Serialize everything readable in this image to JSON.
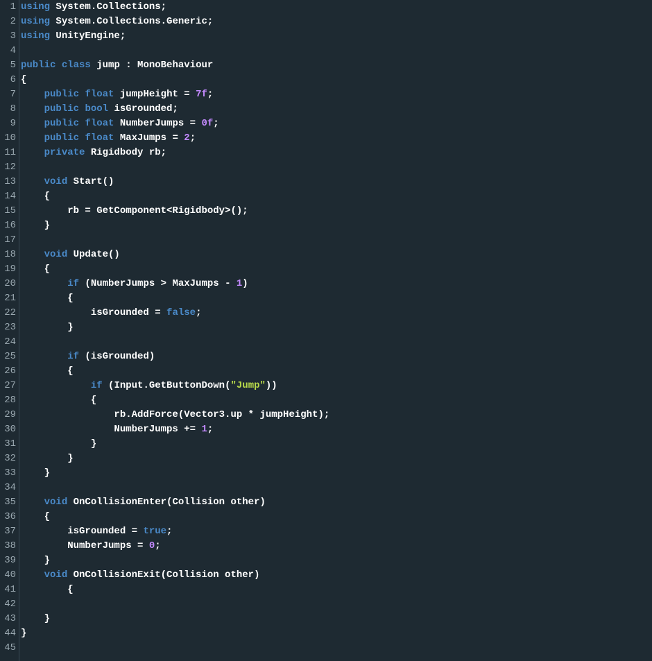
{
  "lines": [
    {
      "n": 1,
      "tokens": [
        {
          "t": "using",
          "c": "kw"
        },
        {
          "t": " System.Collections;",
          "c": "ident"
        }
      ]
    },
    {
      "n": 2,
      "tokens": [
        {
          "t": "using",
          "c": "kw"
        },
        {
          "t": " System.Collections.Generic;",
          "c": "ident"
        }
      ]
    },
    {
      "n": 3,
      "tokens": [
        {
          "t": "using",
          "c": "kw"
        },
        {
          "t": " UnityEngine;",
          "c": "ident"
        }
      ]
    },
    {
      "n": 4,
      "tokens": []
    },
    {
      "n": 5,
      "tokens": [
        {
          "t": "public",
          "c": "kw"
        },
        {
          "t": " ",
          "c": "ident"
        },
        {
          "t": "class",
          "c": "kw"
        },
        {
          "t": " jump : MonoBehaviour",
          "c": "ident"
        }
      ]
    },
    {
      "n": 6,
      "tokens": [
        {
          "t": "{",
          "c": "punc"
        }
      ]
    },
    {
      "n": 7,
      "tokens": [
        {
          "t": "    ",
          "c": "ident"
        },
        {
          "t": "public",
          "c": "kw"
        },
        {
          "t": " ",
          "c": "ident"
        },
        {
          "t": "float",
          "c": "type"
        },
        {
          "t": " jumpHeight = ",
          "c": "ident"
        },
        {
          "t": "7f",
          "c": "num"
        },
        {
          "t": ";",
          "c": "punc"
        }
      ]
    },
    {
      "n": 8,
      "tokens": [
        {
          "t": "    ",
          "c": "ident"
        },
        {
          "t": "public",
          "c": "kw"
        },
        {
          "t": " ",
          "c": "ident"
        },
        {
          "t": "bool",
          "c": "type"
        },
        {
          "t": " isGrounded;",
          "c": "ident"
        }
      ]
    },
    {
      "n": 9,
      "tokens": [
        {
          "t": "    ",
          "c": "ident"
        },
        {
          "t": "public",
          "c": "kw"
        },
        {
          "t": " ",
          "c": "ident"
        },
        {
          "t": "float",
          "c": "type"
        },
        {
          "t": " NumberJumps = ",
          "c": "ident"
        },
        {
          "t": "0f",
          "c": "num"
        },
        {
          "t": ";",
          "c": "punc"
        }
      ]
    },
    {
      "n": 10,
      "tokens": [
        {
          "t": "    ",
          "c": "ident"
        },
        {
          "t": "public",
          "c": "kw"
        },
        {
          "t": " ",
          "c": "ident"
        },
        {
          "t": "float",
          "c": "type"
        },
        {
          "t": " MaxJumps = ",
          "c": "ident"
        },
        {
          "t": "2",
          "c": "num"
        },
        {
          "t": ";",
          "c": "punc"
        }
      ]
    },
    {
      "n": 11,
      "tokens": [
        {
          "t": "    ",
          "c": "ident"
        },
        {
          "t": "private",
          "c": "kw"
        },
        {
          "t": " Rigidbody rb;",
          "c": "ident"
        }
      ]
    },
    {
      "n": 12,
      "tokens": []
    },
    {
      "n": 13,
      "tokens": [
        {
          "t": "    ",
          "c": "ident"
        },
        {
          "t": "void",
          "c": "kw"
        },
        {
          "t": " Start()",
          "c": "ident"
        }
      ]
    },
    {
      "n": 14,
      "tokens": [
        {
          "t": "    {",
          "c": "punc"
        }
      ]
    },
    {
      "n": 15,
      "tokens": [
        {
          "t": "        rb = GetComponent<Rigidbody>();",
          "c": "ident"
        }
      ]
    },
    {
      "n": 16,
      "tokens": [
        {
          "t": "    }",
          "c": "punc"
        }
      ]
    },
    {
      "n": 17,
      "tokens": []
    },
    {
      "n": 18,
      "tokens": [
        {
          "t": "    ",
          "c": "ident"
        },
        {
          "t": "void",
          "c": "kw"
        },
        {
          "t": " Update()",
          "c": "ident"
        }
      ]
    },
    {
      "n": 19,
      "tokens": [
        {
          "t": "    {",
          "c": "punc"
        }
      ]
    },
    {
      "n": 20,
      "tokens": [
        {
          "t": "        ",
          "c": "ident"
        },
        {
          "t": "if",
          "c": "kw"
        },
        {
          "t": " (NumberJumps > MaxJumps - ",
          "c": "ident"
        },
        {
          "t": "1",
          "c": "num"
        },
        {
          "t": ")",
          "c": "punc"
        }
      ]
    },
    {
      "n": 21,
      "tokens": [
        {
          "t": "        {",
          "c": "punc"
        }
      ]
    },
    {
      "n": 22,
      "tokens": [
        {
          "t": "            isGrounded = ",
          "c": "ident"
        },
        {
          "t": "false",
          "c": "boolv"
        },
        {
          "t": ";",
          "c": "punc"
        }
      ]
    },
    {
      "n": 23,
      "tokens": [
        {
          "t": "        }",
          "c": "punc"
        }
      ]
    },
    {
      "n": 24,
      "tokens": []
    },
    {
      "n": 25,
      "tokens": [
        {
          "t": "        ",
          "c": "ident"
        },
        {
          "t": "if",
          "c": "kw"
        },
        {
          "t": " (isGrounded)",
          "c": "ident"
        }
      ]
    },
    {
      "n": 26,
      "tokens": [
        {
          "t": "        {",
          "c": "punc"
        }
      ]
    },
    {
      "n": 27,
      "tokens": [
        {
          "t": "            ",
          "c": "ident"
        },
        {
          "t": "if",
          "c": "kw"
        },
        {
          "t": " (Input.GetButtonDown(",
          "c": "ident"
        },
        {
          "t": "\"Jump\"",
          "c": "str"
        },
        {
          "t": "))",
          "c": "punc"
        }
      ]
    },
    {
      "n": 28,
      "tokens": [
        {
          "t": "            {",
          "c": "punc"
        }
      ]
    },
    {
      "n": 29,
      "tokens": [
        {
          "t": "                rb.AddForce(Vector3.up * jumpHeight);",
          "c": "ident"
        }
      ]
    },
    {
      "n": 30,
      "tokens": [
        {
          "t": "                NumberJumps += ",
          "c": "ident"
        },
        {
          "t": "1",
          "c": "num"
        },
        {
          "t": ";",
          "c": "punc"
        }
      ]
    },
    {
      "n": 31,
      "tokens": [
        {
          "t": "            }",
          "c": "punc"
        }
      ]
    },
    {
      "n": 32,
      "tokens": [
        {
          "t": "        }",
          "c": "punc"
        }
      ]
    },
    {
      "n": 33,
      "tokens": [
        {
          "t": "    }",
          "c": "punc"
        }
      ]
    },
    {
      "n": 34,
      "tokens": []
    },
    {
      "n": 35,
      "tokens": [
        {
          "t": "    ",
          "c": "ident"
        },
        {
          "t": "void",
          "c": "kw"
        },
        {
          "t": " OnCollisionEnter(Collision other)",
          "c": "ident"
        }
      ]
    },
    {
      "n": 36,
      "tokens": [
        {
          "t": "    {",
          "c": "punc"
        }
      ]
    },
    {
      "n": 37,
      "tokens": [
        {
          "t": "        isGrounded = ",
          "c": "ident"
        },
        {
          "t": "true",
          "c": "boolv"
        },
        {
          "t": ";",
          "c": "punc"
        }
      ]
    },
    {
      "n": 38,
      "tokens": [
        {
          "t": "        NumberJumps = ",
          "c": "ident"
        },
        {
          "t": "0",
          "c": "num"
        },
        {
          "t": ";",
          "c": "punc"
        }
      ]
    },
    {
      "n": 39,
      "tokens": [
        {
          "t": "    }",
          "c": "punc"
        }
      ]
    },
    {
      "n": 40,
      "tokens": [
        {
          "t": "    ",
          "c": "ident"
        },
        {
          "t": "void",
          "c": "kw"
        },
        {
          "t": " OnCollisionExit(Collision other)",
          "c": "ident"
        }
      ]
    },
    {
      "n": 41,
      "tokens": [
        {
          "t": "        {",
          "c": "punc"
        }
      ]
    },
    {
      "n": 42,
      "tokens": []
    },
    {
      "n": 43,
      "tokens": [
        {
          "t": "    }",
          "c": "punc"
        }
      ]
    },
    {
      "n": 44,
      "tokens": [
        {
          "t": "}",
          "c": "punc"
        }
      ]
    },
    {
      "n": 45,
      "tokens": []
    }
  ]
}
